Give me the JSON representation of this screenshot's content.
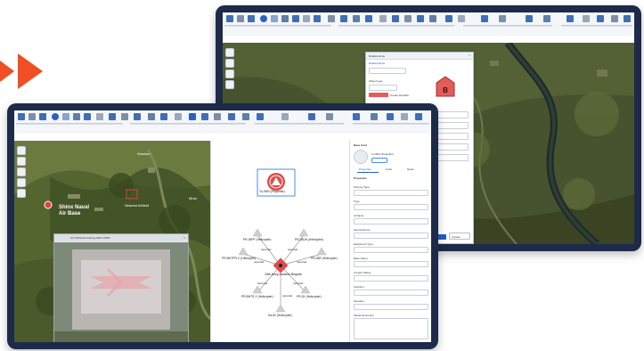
{
  "colors": {
    "accent": "#f04e23",
    "frame": "#1d2a4a",
    "brand": "#1f5fbf"
  },
  "icons": {
    "arrow": "play-arrow-icon"
  },
  "back_window": {
    "dialog_title": "Relationships",
    "tab_relationships": "Relationships",
    "field_label": "Object type",
    "btn_label": "Create Identifier",
    "list_label": "Relationship type",
    "footer_ok": "OK",
    "footer_cancel": "Cancel"
  },
  "front_window": {
    "map_labels": {
      "label_top": "Wushan",
      "base": "Shinx Naval\nAir Base",
      "nearby": "Nearest Airfield",
      "right": "Mula"
    },
    "browser_tab": "(2) GOOGLE Kiwang AETH 000K",
    "graph": {
      "top_node": "Tu-95H (Propeller)",
      "center_node": "15th Army Aviation Brigade",
      "edge_label": "reported",
      "nodes": [
        "PR-35PF (Helicopter)",
        "PR-28LW (Helicopter)",
        "PR-BHTPR-C (Helicopter)",
        "PR-28R (Helicopter)",
        "PR-BHTS-Y (Helicopter)",
        "PR-2K (Helicopter)",
        "Ka-52 (Helicopter)"
      ]
    },
    "right_panel": {
      "title": "Base Card",
      "subtitle": "Tu-95H (Propeller)",
      "tab1": "Properties",
      "tab2": "Links",
      "tab3": "Notes",
      "section": "Properties",
      "fields": [
        "Primary Type",
        "Type",
        "Id Name",
        "Service/Force",
        "Equipment Type",
        "Base Name",
        "Current Status",
        "Function",
        "Operator",
        "Model Document"
      ]
    }
  }
}
